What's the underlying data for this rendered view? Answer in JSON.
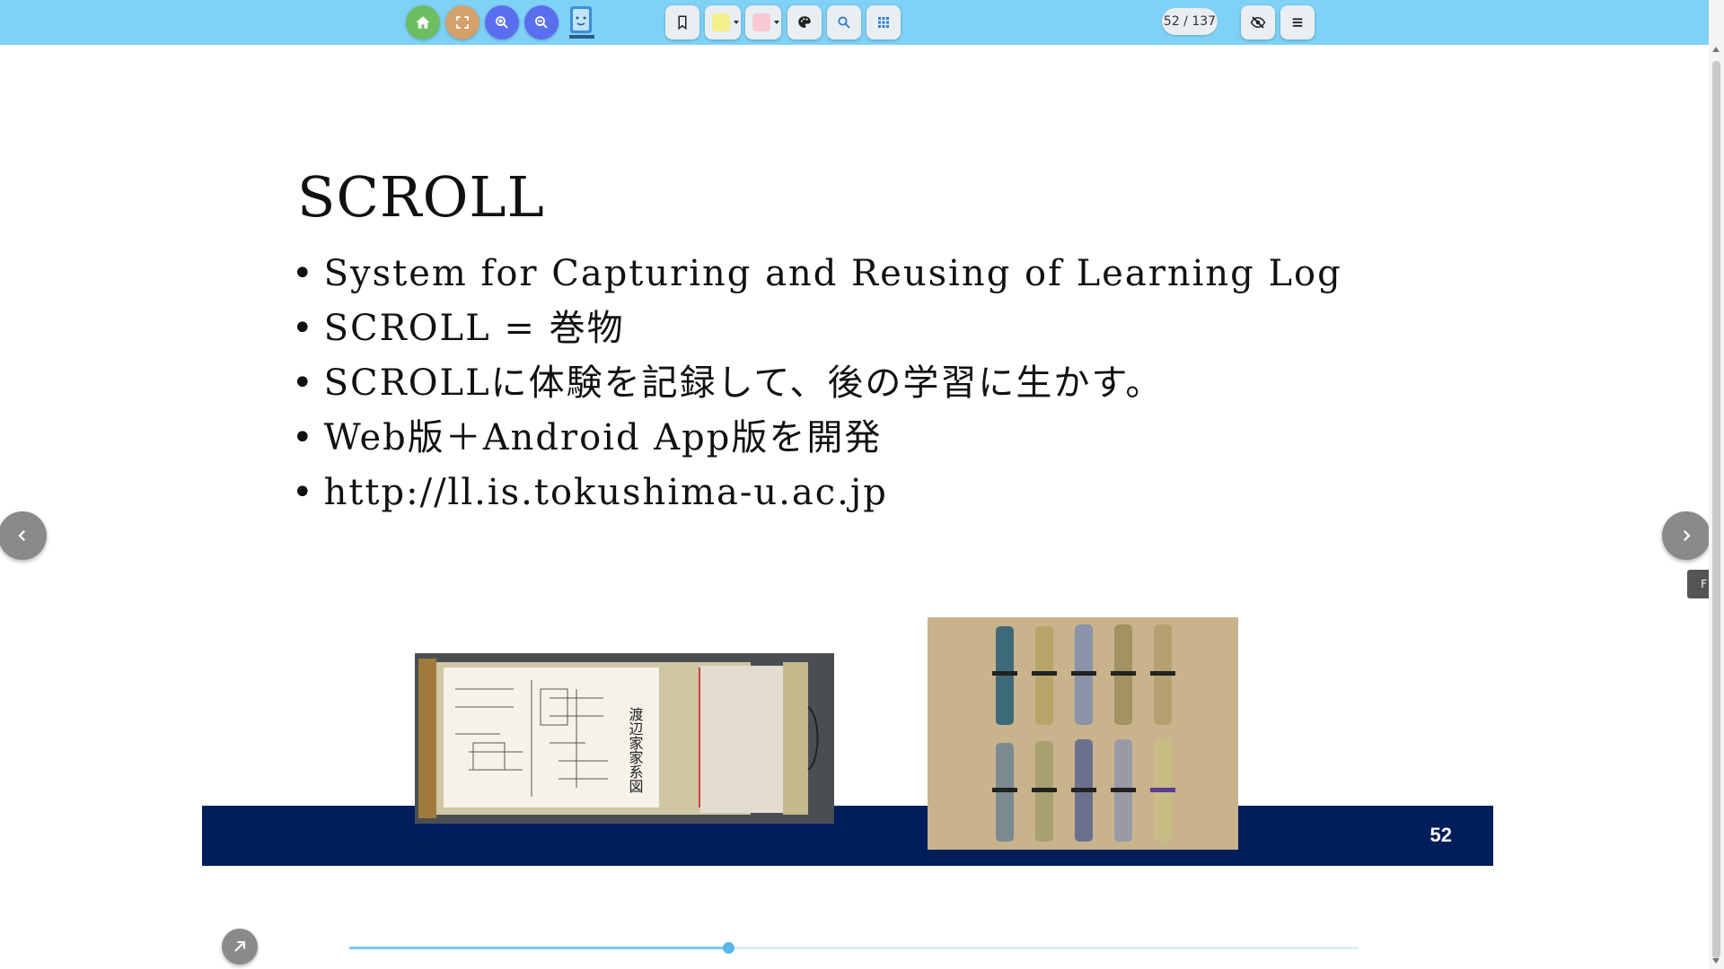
{
  "toolbar": {
    "page_counter": "52 / 137",
    "colors": {
      "home": "#6dbe63",
      "fullscreen": "#d4a16a",
      "zoom": "#5a6ef0",
      "bar": "#7fd2f6"
    },
    "icons": [
      "home-icon",
      "fullscreen-icon",
      "zoom-in-icon",
      "zoom-out-icon",
      "bookmark-icon",
      "highlighter-icon",
      "eraser-icon",
      "palette-icon",
      "search-icon",
      "grid-icon",
      "hide-icon",
      "menu-icon"
    ]
  },
  "slide": {
    "title": "SCROLL",
    "bullets": [
      "System for Capturing and Reusing of Learning Log",
      "SCROLL = 巻物",
      "SCROLLに体験を記録して、後の学習に生かす。",
      "Web版＋Android App版を開発",
      "http://ll.is.tokushima-u.ac.jp"
    ],
    "page_number": "52",
    "footer_color": "#001d5c"
  },
  "side_tab": {
    "label": "F"
  },
  "progress": {
    "current": 52,
    "total": 137
  }
}
